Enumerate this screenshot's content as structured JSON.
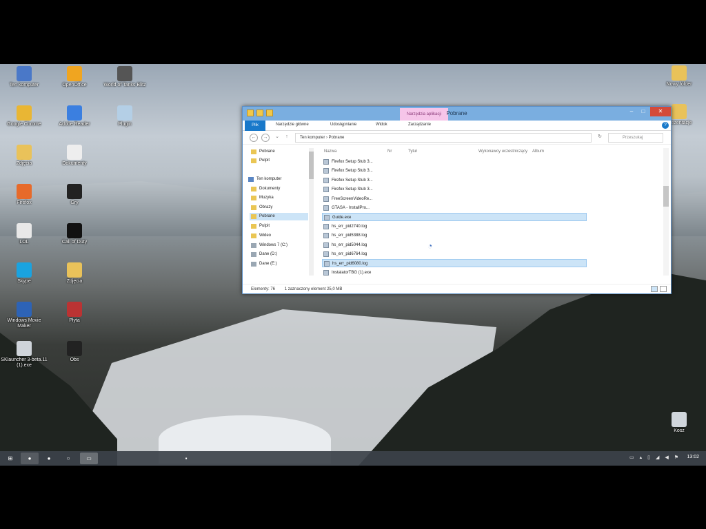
{
  "desktop": {
    "icons_left": [
      {
        "label": "Ten komputer",
        "icon": "computer-icon",
        "color": "#4a78c8"
      },
      {
        "label": "Google Chrome",
        "icon": "chrome-icon",
        "color": "#e9b634"
      },
      {
        "label": "Zdjęcia",
        "icon": "folder-icon",
        "color": "#e9c25a"
      },
      {
        "label": "Firefox",
        "icon": "firefox-icon",
        "color": "#e76a2a"
      },
      {
        "label": "LOL",
        "icon": "file-icon",
        "color": "#e8e8e8"
      },
      {
        "label": "Skype",
        "icon": "skype-icon",
        "color": "#1aa3e0"
      },
      {
        "label": "Windows Movie Maker",
        "icon": "moviemaker-icon",
        "color": "#2d63b6"
      },
      {
        "label": "SKlauncher 3-beta.11 (1).exe",
        "icon": "cog-icon",
        "color": "#cfd4da"
      }
    ],
    "icons_col2": [
      {
        "label": "OpenOffice",
        "icon": "openoffice-icon",
        "color": "#f0a520"
      },
      {
        "label": "Adobe Reader",
        "icon": "reader-icon",
        "color": "#3b7fe0"
      },
      {
        "label": "Dokumenty",
        "icon": "document-icon",
        "color": "#eeeeee"
      },
      {
        "label": "Gry",
        "icon": "game-icon",
        "color": "#222222"
      },
      {
        "label": "Call of Duty",
        "icon": "cod-icon",
        "color": "#111111"
      },
      {
        "label": "Zdjęcia",
        "icon": "folder-icon",
        "color": "#e9c25a"
      },
      {
        "label": "Płyta",
        "icon": "media-icon",
        "color": "#b33"
      },
      {
        "label": "Obs",
        "icon": "obs-icon",
        "color": "#222"
      }
    ],
    "icons_col3": [
      {
        "label": "World of Tanks Blitz",
        "icon": "tanks-icon",
        "color": "#555"
      },
      {
        "label": "Plugin",
        "icon": "plugin-icon",
        "color": "#b4cfe6"
      }
    ],
    "icons_right": [
      {
        "label": "Nowy folder",
        "icon": "folder-icon",
        "color": "#e9c25a"
      },
      {
        "label": "Prezentacje",
        "icon": "folder-icon",
        "color": "#e9c25a"
      },
      {
        "label": "Kosz",
        "icon": "recycle-bin-icon",
        "color": "#d0d6dc"
      }
    ]
  },
  "window": {
    "title": "Pobrane",
    "context_tab": "Narzędzia aplikacji",
    "ribbon_tabs": [
      "Plik",
      "Narzędzie główne",
      "Udostępnianie",
      "Widok",
      "Zarządzanie"
    ],
    "address": "Ten komputer  ›  Pobrane",
    "search_placeholder": "Przeszukaj",
    "nav_items": [
      {
        "label": "Pobrane",
        "selected": false
      },
      {
        "label": "Pulpit",
        "selected": false
      },
      {
        "label": "Ten komputer",
        "selected": false
      },
      {
        "label": "Dokumenty",
        "selected": false
      },
      {
        "label": "Muzyka",
        "selected": false
      },
      {
        "label": "Obrazy",
        "selected": false
      },
      {
        "label": "Pobrane",
        "selected": true
      },
      {
        "label": "Pulpit",
        "selected": false
      },
      {
        "label": "Wideo",
        "selected": false
      },
      {
        "label": "Windows 7 (C:)",
        "selected": false
      },
      {
        "label": "Dane (D:)",
        "selected": false
      },
      {
        "label": "Dane (E:)",
        "selected": false
      }
    ],
    "columns": [
      "Nazwa",
      "Nr",
      "Tytuł",
      "Wykonawcy uczestniczący",
      "Album"
    ],
    "files": [
      {
        "name": "Firefox Setup Stub 3...",
        "selected": false
      },
      {
        "name": "Firefox Setup Stub 3...",
        "selected": false
      },
      {
        "name": "Firefox Setup Stub 3...",
        "selected": false
      },
      {
        "name": "Firefox Setup Stub 3...",
        "selected": false
      },
      {
        "name": "FreeScreenVideoRe...",
        "selected": false
      },
      {
        "name": "GTASA - InstallPro...",
        "selected": false
      },
      {
        "name": "Guide.exe",
        "selected": true
      },
      {
        "name": "hs_err_pid2740.log",
        "selected": false
      },
      {
        "name": "hs_err_pid5388.log",
        "selected": false
      },
      {
        "name": "hs_err_pid5044.log",
        "selected": false
      },
      {
        "name": "hs_err_pid6764.log",
        "selected": false
      },
      {
        "name": "hs_err_pid6080.log",
        "selected": true
      },
      {
        "name": "InstalatorTBG (1).exe",
        "selected": false
      }
    ],
    "status_count": "Elementy: 76",
    "status_selected": "1 zaznaczony element  25,0 MB"
  },
  "taskbar": {
    "clock": "13:02",
    "apps": [
      "start-icon",
      "chrome-icon",
      "obs-icon",
      "media-icon",
      "explorer-icon"
    ]
  },
  "colors": {
    "titlebar": "#7aaee0",
    "selection": "#cce4f7",
    "file_tab": "#1979ca",
    "close": "#d44a3a"
  }
}
